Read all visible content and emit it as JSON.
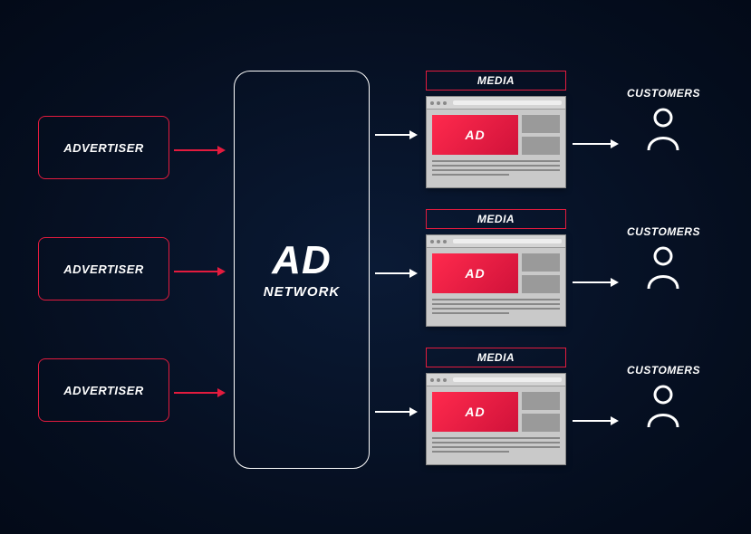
{
  "advertisers": [
    {
      "label": "ADVERTISER"
    },
    {
      "label": "ADVERTISER"
    },
    {
      "label": "ADVERTISER"
    }
  ],
  "network": {
    "title": "AD",
    "subtitle": "NETWORK"
  },
  "media": [
    {
      "label": "MEDIA",
      "ad_text": "AD"
    },
    {
      "label": "MEDIA",
      "ad_text": "AD"
    },
    {
      "label": "MEDIA",
      "ad_text": "AD"
    }
  ],
  "customers": [
    {
      "label": "CUSTOMERS"
    },
    {
      "label": "CUSTOMERS"
    },
    {
      "label": "CUSTOMERS"
    }
  ]
}
